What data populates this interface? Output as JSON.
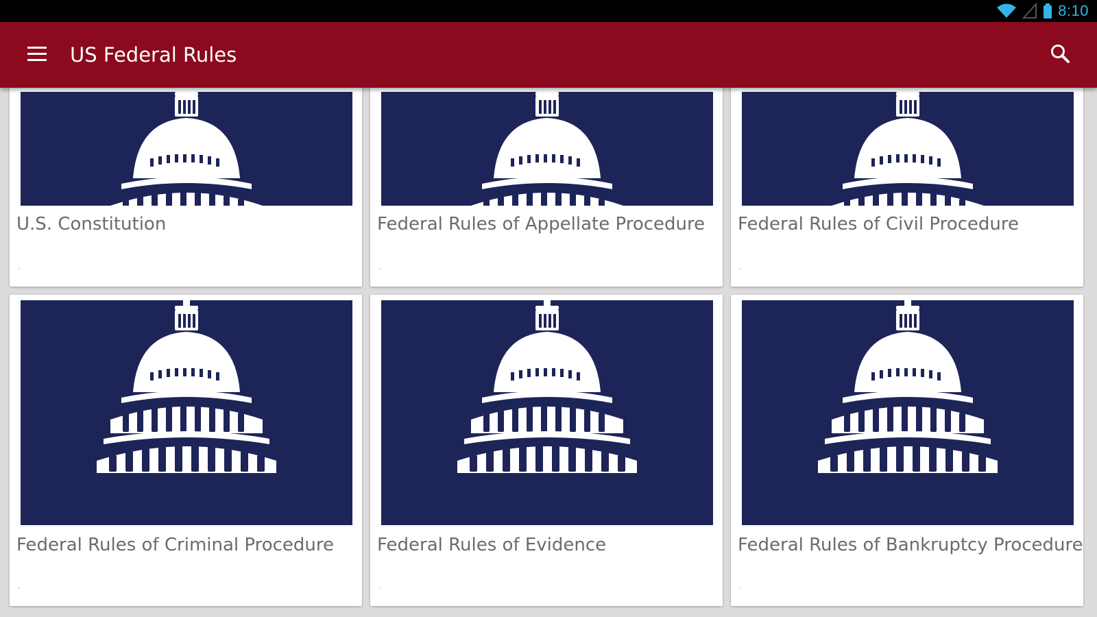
{
  "status_bar": {
    "time": "8:10"
  },
  "app_bar": {
    "title": "US Federal Rules"
  },
  "cards": [
    {
      "title": "U.S. Constitution",
      "subtitle": "."
    },
    {
      "title": "Federal Rules of Appellate Procedure",
      "subtitle": "."
    },
    {
      "title": "Federal Rules of Civil Procedure",
      "subtitle": "."
    },
    {
      "title": "Federal Rules of Criminal Procedure",
      "subtitle": "."
    },
    {
      "title": "Federal Rules of Evidence",
      "subtitle": "."
    },
    {
      "title": "Federal Rules of Bankruptcy Procedure",
      "subtitle": "."
    }
  ],
  "icons": [
    "menu-icon",
    "search-icon",
    "wifi-icon",
    "signal-icon",
    "battery-icon",
    "capitol-dome-icon"
  ],
  "colors": {
    "app_bar": "#8b0a1e",
    "card_image_bg": "#1d2458",
    "status_accent": "#33b5e5"
  }
}
